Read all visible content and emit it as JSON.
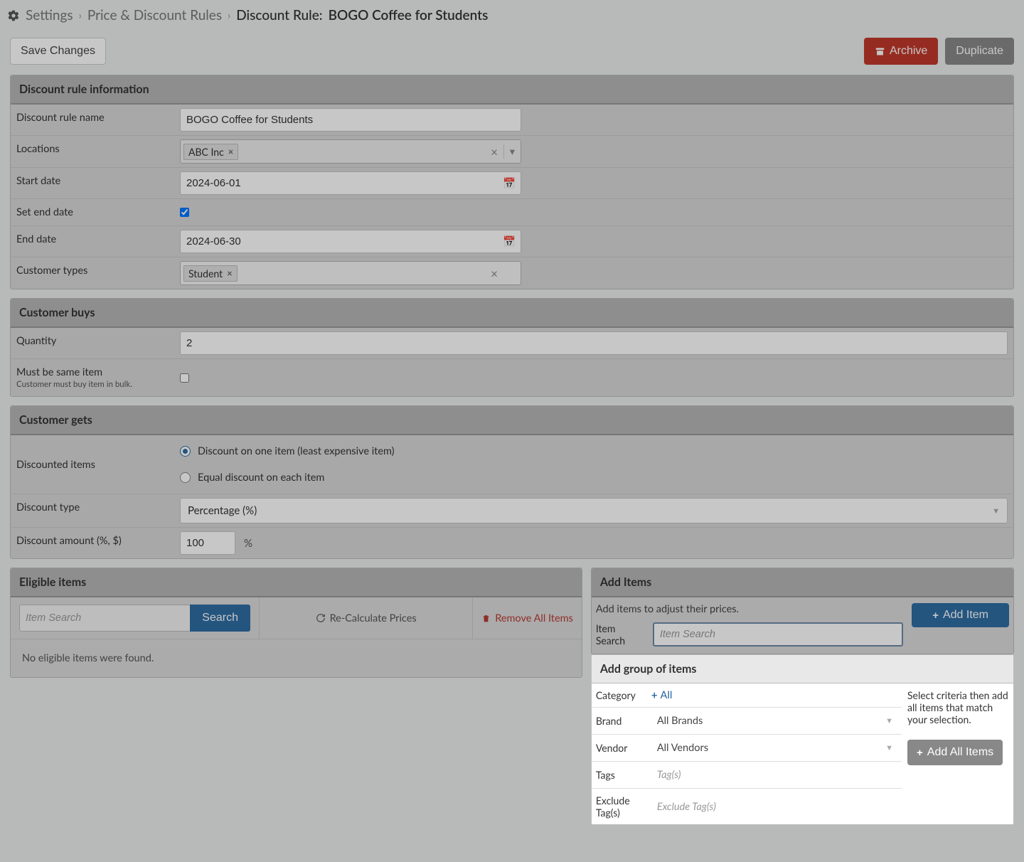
{
  "breadcrumb": {
    "settings": "Settings",
    "rules": "Price & Discount Rules",
    "current_label": "Discount Rule:",
    "current_value": "BOGO Coffee for Students"
  },
  "actions": {
    "save": "Save Changes",
    "archive": "Archive",
    "duplicate": "Duplicate"
  },
  "info": {
    "header": "Discount rule information",
    "name_label": "Discount rule name",
    "name_value": "BOGO Coffee for Students",
    "locations_label": "Locations",
    "location_tag": "ABC Inc",
    "start_label": "Start date",
    "start_value": "2024-06-01",
    "set_end_label": "Set end date",
    "end_label": "End date",
    "end_value": "2024-06-30",
    "cust_types_label": "Customer types",
    "cust_types_value": "Student"
  },
  "buys": {
    "header": "Customer buys",
    "qty_label": "Quantity",
    "qty_value": "2",
    "same_label": "Must be same item",
    "same_sub": "Customer must buy item in bulk."
  },
  "gets": {
    "header": "Customer gets",
    "discounted_label": "Discounted items",
    "opt1": "Discount on one item (least expensive item)",
    "opt2": "Equal discount on each item",
    "type_label": "Discount type",
    "type_value": "Percentage   (%)",
    "amount_label": "Discount amount (%, $)",
    "amount_value": "100",
    "amount_suffix": "%"
  },
  "eligible": {
    "header": "Eligible items",
    "search_ph": "Item Search",
    "search_btn": "Search",
    "recalc": "Re-Calculate Prices",
    "remove_all": "Remove All Items",
    "empty": "No eligible items were found."
  },
  "add_items": {
    "header": "Add Items",
    "hint": "Add items to adjust their prices.",
    "search_label": "Item Search",
    "search_ph": "Item Search",
    "add_btn": "Add Item"
  },
  "group": {
    "header": "Add group of items",
    "category_label": "Category",
    "category_all": "All",
    "brand_label": "Brand",
    "brand_value": "All Brands",
    "vendor_label": "Vendor",
    "vendor_value": "All Vendors",
    "tags_label": "Tags",
    "tags_ph": "Tag(s)",
    "excl_label": "Exclude Tag(s)",
    "excl_ph": "Exclude Tag(s)",
    "hint": "Select criteria then add all items that match your selection.",
    "add_all": "Add All Items"
  }
}
